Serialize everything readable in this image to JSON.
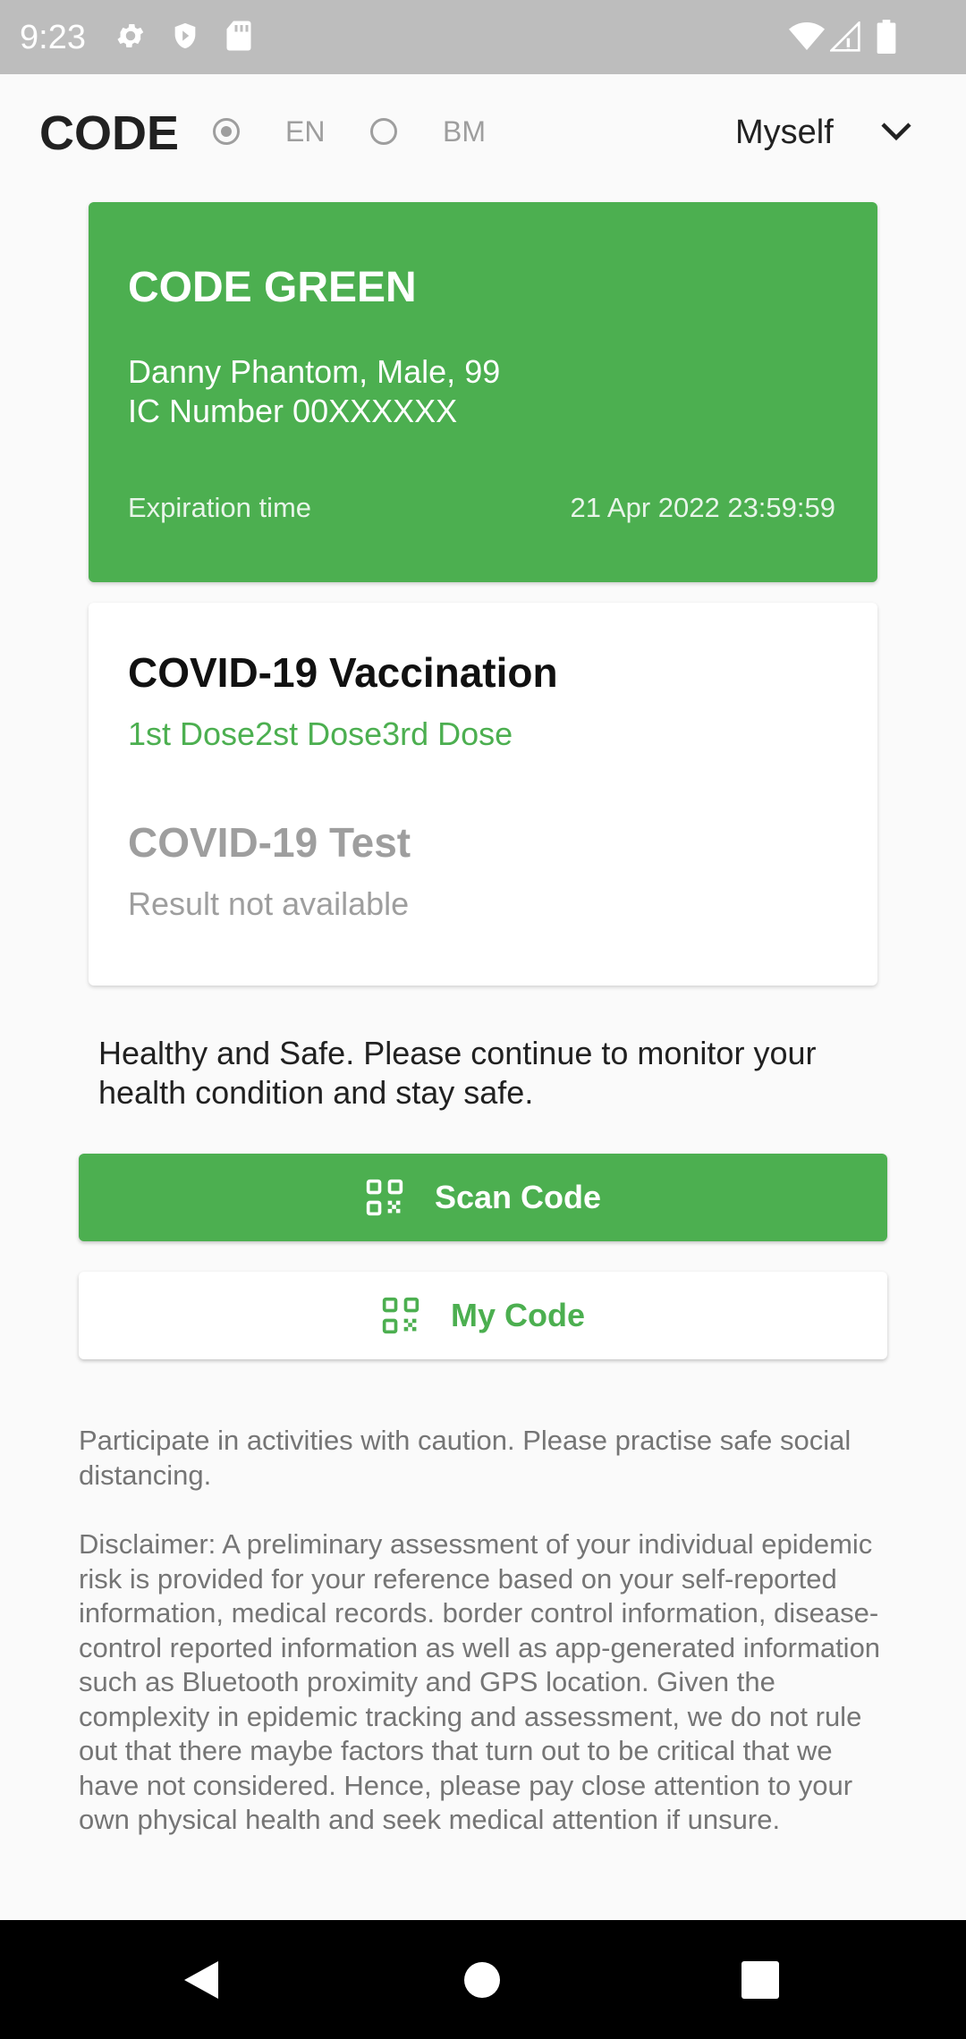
{
  "status_bar": {
    "time": "9:23",
    "icons": [
      "settings-icon",
      "shield-icon",
      "sd-card-icon",
      "wifi-icon",
      "signal-icon",
      "battery-icon"
    ]
  },
  "header": {
    "title": "CODE",
    "languages": [
      {
        "label": "EN",
        "selected": true
      },
      {
        "label": "BM",
        "selected": false
      }
    ],
    "profile_select": "Myself"
  },
  "code_card": {
    "status": "CODE GREEN",
    "person": "Danny Phantom, Male, 99",
    "ic_number": "IC Number 00XXXXXX",
    "expiration_label": "Expiration time",
    "expiration_value": "21 Apr 2022 23:59:59",
    "color": "#4caf50"
  },
  "health_card": {
    "vaccination_title": "COVID-19 Vaccination",
    "vaccination_doses": "1st Dose2st Dose3rd Dose",
    "test_title": "COVID-19 Test",
    "test_result": "Result not available"
  },
  "message": "Healthy and Safe. Please continue to monitor your health condition and stay safe.",
  "buttons": {
    "scan_code": "Scan Code",
    "my_code": "My Code"
  },
  "notes": {
    "caution": "Participate in activities with caution. Please practise safe social distancing.",
    "disclaimer": "Disclaimer: A preliminary assessment of your individual epidemic risk is provided for your reference based on your self-reported information, medical records. border control information, disease-control reported information as well as app-generated information such as Bluetooth proximity and GPS location. Given the complexity in epidemic tracking and assessment, we do not rule out that there maybe factors that turn out to be critical that we have not considered. Hence, please pay close attention to your own physical health and seek medical attention if unsure."
  },
  "nav_bar": {
    "icons": [
      "back-icon",
      "home-icon",
      "recents-icon"
    ]
  }
}
